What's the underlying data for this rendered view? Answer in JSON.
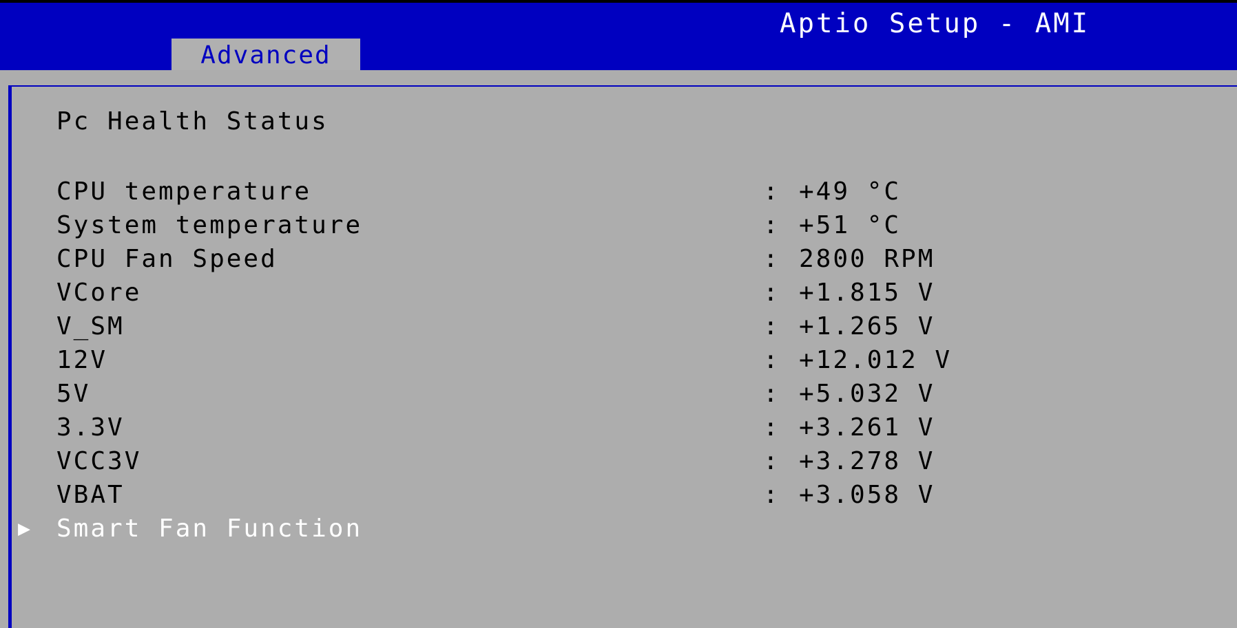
{
  "header": {
    "title": "Aptio Setup - AMI",
    "active_tab": "Advanced"
  },
  "page": {
    "heading": "Pc Health Status",
    "separator": ":",
    "items": [
      {
        "label": "CPU temperature",
        "value": "+49 °C"
      },
      {
        "label": "System temperature",
        "value": "+51 °C"
      },
      {
        "label": "CPU Fan Speed",
        "value": "2800 RPM"
      },
      {
        "label": "VCore",
        "value": "+1.815 V"
      },
      {
        "label": "V_SM",
        "value": "+1.265 V"
      },
      {
        "label": "12V",
        "value": "+12.012 V"
      },
      {
        "label": "5V",
        "value": "+5.032 V"
      },
      {
        "label": "3.3V",
        "value": "+3.261 V"
      },
      {
        "label": "VCC3V",
        "value": "+3.278 V"
      },
      {
        "label": "VBAT",
        "value": "+3.058 V"
      }
    ],
    "submenu": {
      "label": "Smart Fan Function",
      "arrow_icon": "play-triangle-icon",
      "arrow_glyph": "▶"
    }
  },
  "colors": {
    "header_blue": "#0000c0",
    "panel_gray": "#adadad",
    "tab_gray": "#b0b0b0",
    "text_black": "#000000",
    "text_white": "#ffffff"
  }
}
